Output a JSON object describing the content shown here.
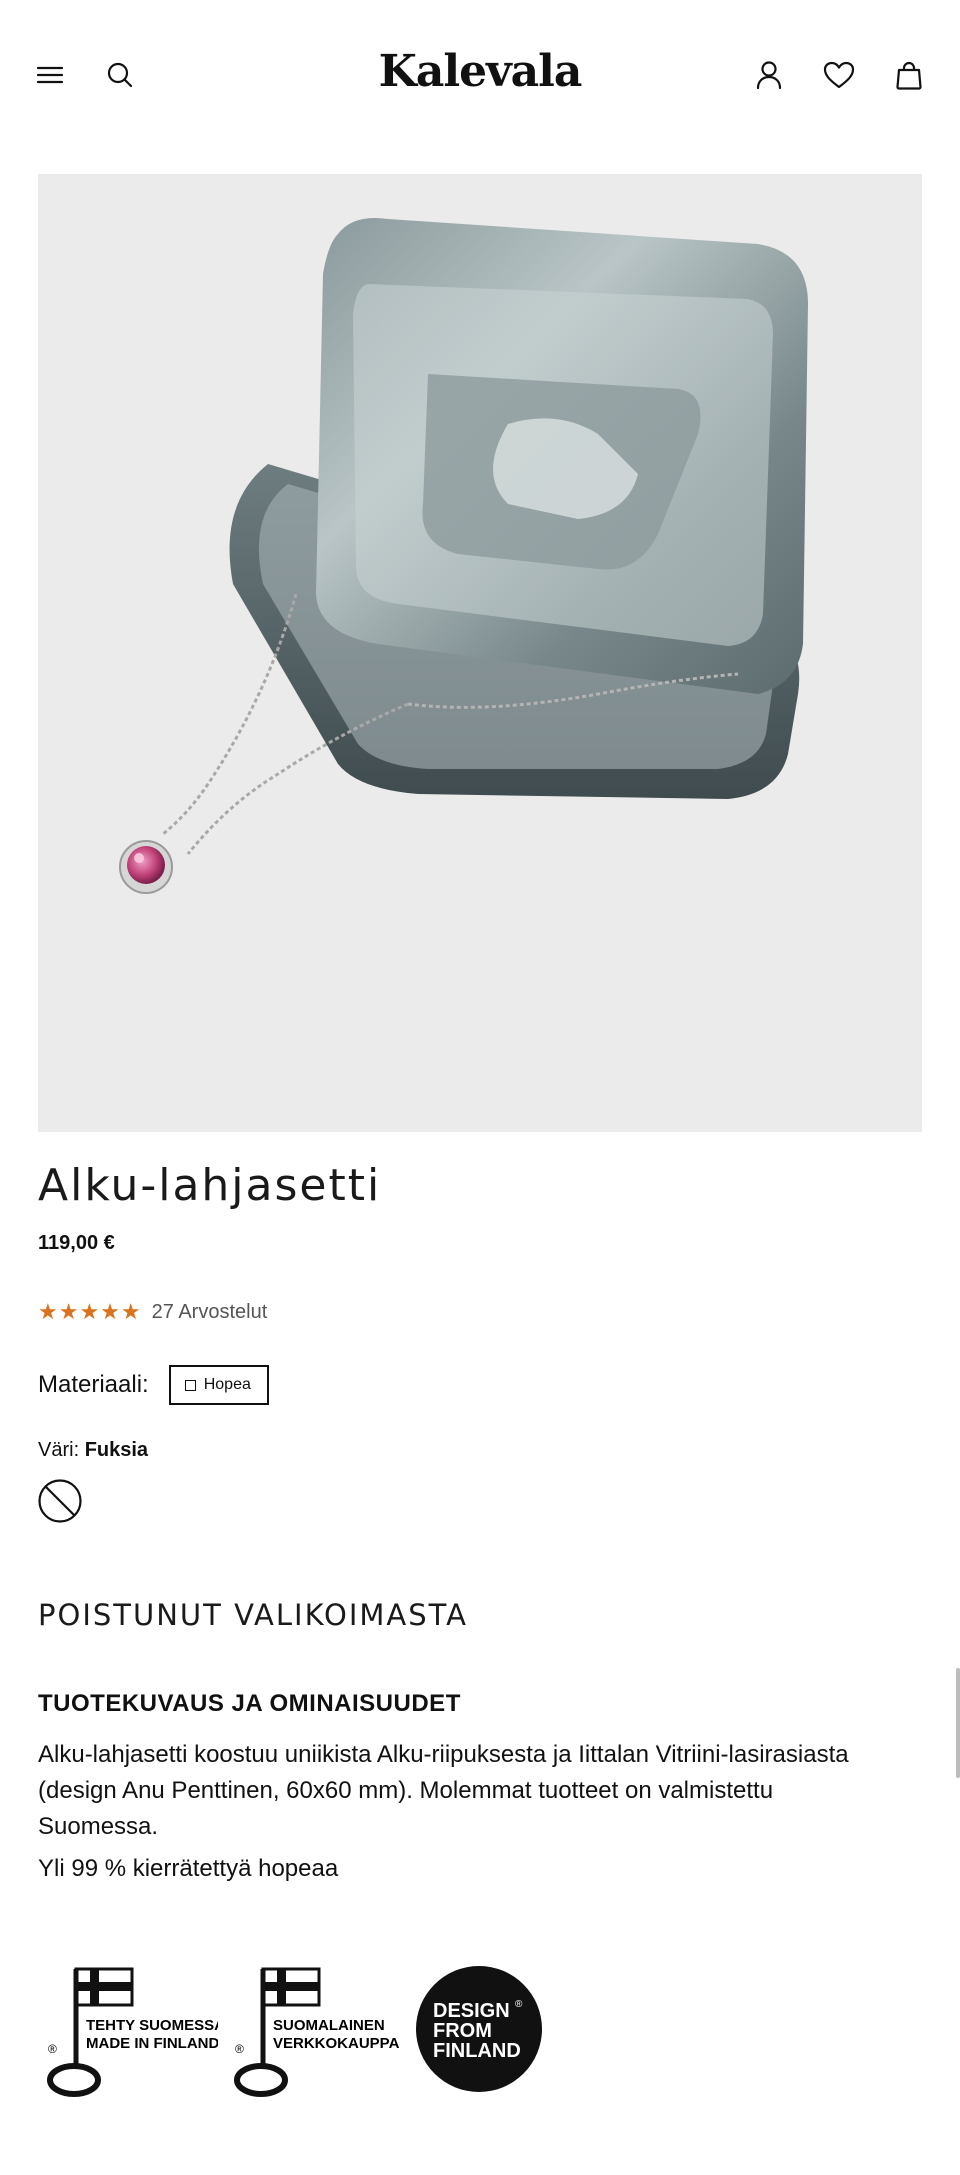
{
  "header": {
    "menu_icon": "menu-icon",
    "search_icon": "search-icon",
    "logo": "Kalevala",
    "account_icon": "account-icon",
    "wishlist_icon": "heart-icon",
    "cart_icon": "bag-icon"
  },
  "product": {
    "title": "Alku-lahjasetti",
    "price": "119,00 €",
    "rating_stars": 5,
    "reviews": "27 Arvostelut",
    "material_label": "Materiaali:",
    "material_value": "Hopea",
    "color_label": "Väri:",
    "color_value": "Fuksia",
    "availability": "POISTUNUT VALIKOIMASTA"
  },
  "description": {
    "heading": "TUOTEKUVAUS JA OMINAISUUDET",
    "text": "Alku-lahjasetti koostuu uniikista Alku-riipuksesta ja Iittalan Vitriini-lasirasiasta (design Anu Penttinen, 60x60 mm). Molemmat tuotteet on valmistettu Suomessa.",
    "text2": "Yli 99 % kierrätettyä hopeaa"
  },
  "badges": [
    {
      "line1": "TEHTY SUOMESSA",
      "line2": "MADE IN FINLAND"
    },
    {
      "line1": "SUOMALAINEN",
      "line2": "VERKKOKAUPPA"
    },
    {
      "line1": "DESIGN",
      "line2": "FROM",
      "line3": "FINLAND"
    }
  ],
  "colors": {
    "star": "#d9731f",
    "hero_bg": "#ebebeb",
    "gem": "#c2447a"
  }
}
